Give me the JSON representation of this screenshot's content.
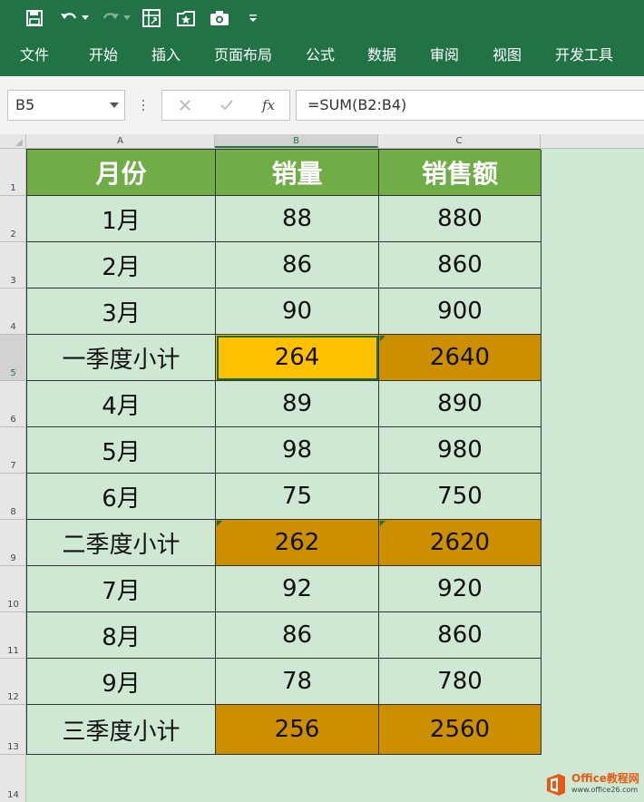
{
  "colors": {
    "ribbon": "#217346",
    "header_fill": "#70ad47",
    "highlight_fill": "#cc8f00",
    "active_fill": "#ffc000",
    "sheet_bg": "#cfe8d4"
  },
  "toolbar": {
    "icons": [
      "save-icon",
      "undo-icon",
      "redo-icon",
      "pivot-table-icon",
      "macro-icon",
      "camera-icon",
      "customize-qat-icon"
    ]
  },
  "ribbon": {
    "tabs": [
      "文件",
      "开始",
      "插入",
      "页面布局",
      "公式",
      "数据",
      "审阅",
      "视图",
      "开发工具"
    ]
  },
  "formula_bar": {
    "name_box": "B5",
    "fx_label": "fx",
    "formula": "=SUM(B2:B4)"
  },
  "sheet": {
    "columns": [
      "A",
      "B",
      "C"
    ],
    "row_numbers": [
      "1",
      "2",
      "3",
      "4",
      "5",
      "6",
      "7",
      "8",
      "9",
      "10",
      "11",
      "12",
      "13",
      "14"
    ],
    "header": [
      "月份",
      "销量",
      "销售额"
    ],
    "rows": [
      [
        "1月",
        "88",
        "880"
      ],
      [
        "2月",
        "86",
        "860"
      ],
      [
        "3月",
        "90",
        "900"
      ],
      [
        "一季度小计",
        "264",
        "2640"
      ],
      [
        "4月",
        "89",
        "890"
      ],
      [
        "5月",
        "98",
        "980"
      ],
      [
        "6月",
        "75",
        "750"
      ],
      [
        "二季度小计",
        "262",
        "2620"
      ],
      [
        "7月",
        "92",
        "920"
      ],
      [
        "8月",
        "86",
        "860"
      ],
      [
        "9月",
        "78",
        "780"
      ],
      [
        "三季度小计",
        "256",
        "2560"
      ]
    ],
    "active_cell": "B5"
  },
  "watermark": {
    "brand": "Office教程网",
    "url": "www.office26.com"
  }
}
